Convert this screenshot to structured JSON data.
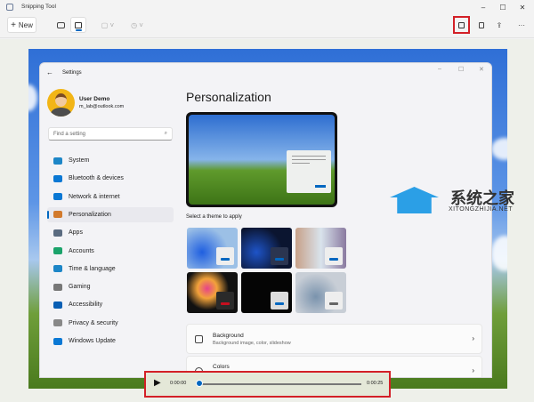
{
  "app": {
    "title": "Snipping Tool",
    "new_label": "New",
    "minimize": "–",
    "maximize": "☐",
    "close": "✕",
    "more": "···"
  },
  "settings": {
    "title": "Settings",
    "user_name": "User Demo",
    "user_email": "m_lab@outlook.com",
    "search_placeholder": "Find a setting",
    "nav": [
      {
        "label": "System",
        "color": "#1d86c7"
      },
      {
        "label": "Bluetooth & devices",
        "color": "#0a78d4"
      },
      {
        "label": "Network & internet",
        "color": "#0a78d4"
      },
      {
        "label": "Personalization",
        "color": "#d27a2c",
        "selected": true
      },
      {
        "label": "Apps",
        "color": "#5a6b80"
      },
      {
        "label": "Accounts",
        "color": "#1ba36b"
      },
      {
        "label": "Time & language",
        "color": "#1d86c7"
      },
      {
        "label": "Gaming",
        "color": "#777"
      },
      {
        "label": "Accessibility",
        "color": "#0a5fb4"
      },
      {
        "label": "Privacy & security",
        "color": "#888"
      },
      {
        "label": "Windows Update",
        "color": "#0a78d4"
      }
    ],
    "page_title": "Personalization",
    "theme_label": "Select a theme to apply",
    "cards": [
      {
        "title": "Background",
        "subtitle": "Background image, color, slideshow"
      },
      {
        "title": "Colors",
        "subtitle": ""
      }
    ]
  },
  "player": {
    "current_time": "0:00:00",
    "total_time": "0:00:25",
    "progress": 0
  },
  "watermark": {
    "cn": "系统之家",
    "en": "XITONGZHIJIA.NET"
  },
  "colors": {
    "accent": "#0067c0",
    "highlight": "#d32027"
  }
}
